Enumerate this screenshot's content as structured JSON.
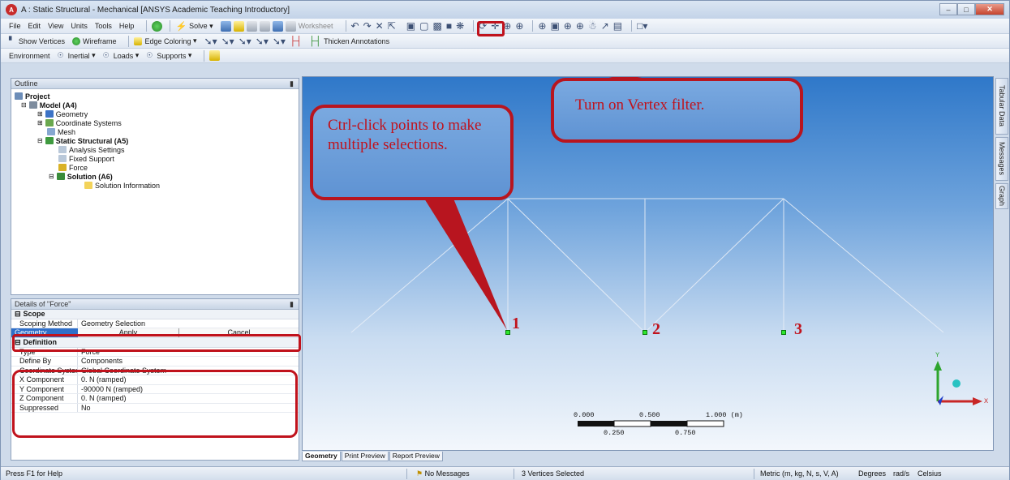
{
  "window": {
    "title": "A : Static Structural - Mechanical [ANSYS Academic Teaching Introductory]",
    "app_icon": "ansys-logo-icon"
  },
  "menubar": {
    "file": "File",
    "edit": "Edit",
    "view": "View",
    "units": "Units",
    "tools": "Tools",
    "help": "Help",
    "solve": "Solve",
    "worksheet": "Worksheet"
  },
  "toolbar2": {
    "show_vertices": "Show Vertices",
    "wireframe": "Wireframe",
    "edge_coloring": "Edge Coloring",
    "thicken_annotations": "Thicken Annotations"
  },
  "toolbar3": {
    "environment": "Environment",
    "inertial": "Inertial",
    "loads": "Loads",
    "supports": "Supports"
  },
  "outline": {
    "header": "Outline",
    "pin": "1",
    "items": [
      "Project",
      "Model (A4)",
      "Geometry",
      "Coordinate Systems",
      "Mesh",
      "Static Structural (A5)",
      "Analysis Settings",
      "Fixed Support",
      "Force",
      "Solution (A6)",
      "Solution Information"
    ]
  },
  "details": {
    "header": "Details of \"Force\"",
    "scope": "Scope",
    "scoping_method_label": "Scoping Method",
    "scoping_method_value": "Geometry Selection",
    "geometry_label": "Geometry",
    "apply": "Apply",
    "cancel": "Cancel",
    "definition": "Definition",
    "type_label": "Type",
    "type_value": "Force",
    "define_by_label": "Define By",
    "define_by_value": "Components",
    "coord_label": "Coordinate System",
    "coord_value": "Global Coordinate System",
    "x_label": "X Component",
    "x_value": "0. N  (ramped)",
    "y_label": "Y Component",
    "y_value": "-90000 N  (ramped)",
    "z_label": "Z Component",
    "z_value": "0. N  (ramped)",
    "suppressed_label": "Suppressed",
    "suppressed_value": "No"
  },
  "viewport": {
    "callout_ctrl": "Ctrl-click points to make multiple selections.",
    "callout_vertex": "Turn on Vertex filter.",
    "points": [
      "1",
      "2",
      "3"
    ],
    "scale_top": [
      "0.000",
      "0.500",
      "1.000 (m)"
    ],
    "scale_bottom": [
      "0.250",
      "0.750"
    ],
    "axis_x": "X",
    "axis_y": "Y"
  },
  "side_tabs": [
    "Tabular Data",
    "Messages",
    "Graph"
  ],
  "bottom_tabs": [
    "Geometry",
    "Print Preview",
    "Report Preview"
  ],
  "status": {
    "help": "Press F1 for Help",
    "messages": "No Messages",
    "selection": "3 Vertices Selected",
    "units": "Metric (m, kg, N, s, V, A)",
    "angle": "Degrees",
    "rot": "rad/s",
    "temp": "Celsius"
  },
  "colors": {
    "highlight": "#c0121c",
    "selected_vertex": "#2ee62e"
  }
}
